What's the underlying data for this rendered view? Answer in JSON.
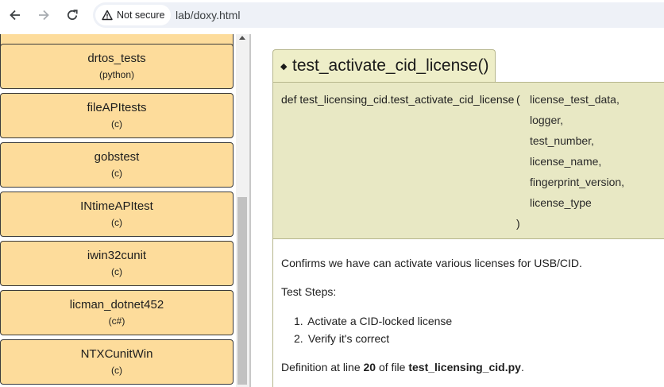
{
  "browser": {
    "security_label": "Not secure",
    "url": "lab/doxy.html"
  },
  "nav": {
    "items": [
      {
        "name": "drtos_tests",
        "lang": "(python)"
      },
      {
        "name": "fileAPItests",
        "lang": "(c)"
      },
      {
        "name": "gobstest",
        "lang": "(c)"
      },
      {
        "name": "INtimeAPItest",
        "lang": "(c)"
      },
      {
        "name": "iwin32cunit",
        "lang": "(c)"
      },
      {
        "name": "licman_dotnet452",
        "lang": "(c#)"
      },
      {
        "name": "NTXCunitWin",
        "lang": "(c)"
      }
    ]
  },
  "member": {
    "title": "test_activate_cid_license()",
    "prototype_prefix": "def test_licensing_cid.test_activate_cid_license",
    "open_paren": "(",
    "close_paren": ")",
    "params": [
      "license_test_data,",
      "logger,",
      "test_number,",
      "license_name,",
      "fingerprint_version,",
      "license_type"
    ],
    "description": "Confirms we have can activate various licenses for USB/CID.",
    "steps_heading": "Test Steps:",
    "steps": [
      {
        "num": "1.",
        "text": "Activate a CID-locked license"
      },
      {
        "num": "2.",
        "text": "Verify it's correct"
      }
    ],
    "definition": {
      "prefix": "Definition at line ",
      "line": "20",
      "middle": " of file ",
      "file": "test_licensing_cid.py",
      "suffix": "."
    }
  },
  "colors": {
    "nav_item_bg": "#fddc9b",
    "memtitle_bg": "#eeeec8",
    "memproto_bg": "#e8e8c4"
  }
}
